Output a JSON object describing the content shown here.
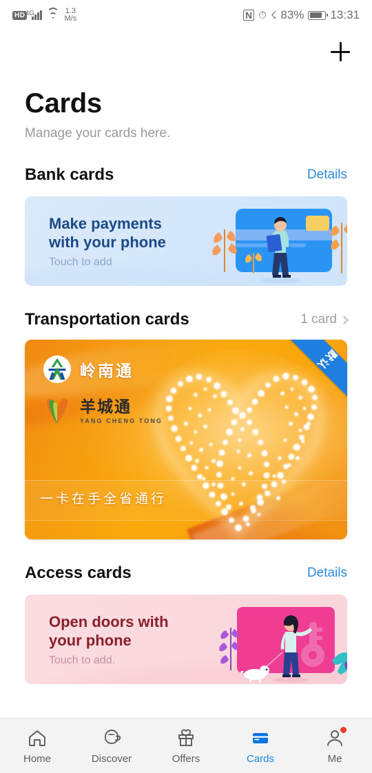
{
  "status_bar": {
    "hd_label": "HD",
    "network_type": "4G",
    "net_speed_value": "1.3",
    "net_speed_unit": "M/s",
    "nfc_label": "N",
    "battery_percent": "83%",
    "battery_level": 83,
    "time": "13:31",
    "icons": [
      "hd-icon",
      "signal-icon",
      "wifi-icon",
      "nfc-icon",
      "alarm-icon",
      "bluetooth-icon",
      "battery-icon"
    ]
  },
  "header": {
    "add_icon": "plus-icon",
    "title": "Cards",
    "subtitle": "Manage your cards here."
  },
  "sections": {
    "bank": {
      "title": "Bank cards",
      "link_label": "Details",
      "banner": {
        "heading_line1": "Make payments",
        "heading_line2": "with your phone",
        "subtext": "Touch to add",
        "bg_color": "#d7e8fb",
        "heading_color": "#1b4a86",
        "art": "person-with-blue-card-illustration"
      }
    },
    "transportation": {
      "title": "Transportation cards",
      "count_label": "1 card",
      "chevron_icon": "chevron-right-icon",
      "card": {
        "brand_primary_cn": "岭南通",
        "brand_secondary_cn": "羊城通",
        "brand_secondary_pinyin": "YANG CHENG TONG",
        "slogan_cn": "一卡在手全省通行",
        "ribbon_label_cn": "默认",
        "ribbon_color": "#1f7fe0",
        "card_color": "#f7a20d",
        "art": "sparkling-heart-illustration"
      }
    },
    "access": {
      "title": "Access cards",
      "link_label": "Details",
      "banner": {
        "heading_line1": "Open doors with",
        "heading_line2": "your phone",
        "subtext": "Touch to add.",
        "bg_color": "#fad9de",
        "heading_color": "#8a1f2c",
        "art": "woman-with-key-illustration"
      }
    }
  },
  "bottom_nav": {
    "active_color": "#1a84e2",
    "items": [
      {
        "label": "Home",
        "icon": "home-icon",
        "active": false,
        "badge": false
      },
      {
        "label": "Discover",
        "icon": "compass-icon",
        "active": false,
        "badge": false
      },
      {
        "label": "Offers",
        "icon": "gift-icon",
        "active": false,
        "badge": false
      },
      {
        "label": "Cards",
        "icon": "card-icon",
        "active": true,
        "badge": false
      },
      {
        "label": "Me",
        "icon": "person-icon",
        "active": false,
        "badge": true
      }
    ]
  }
}
